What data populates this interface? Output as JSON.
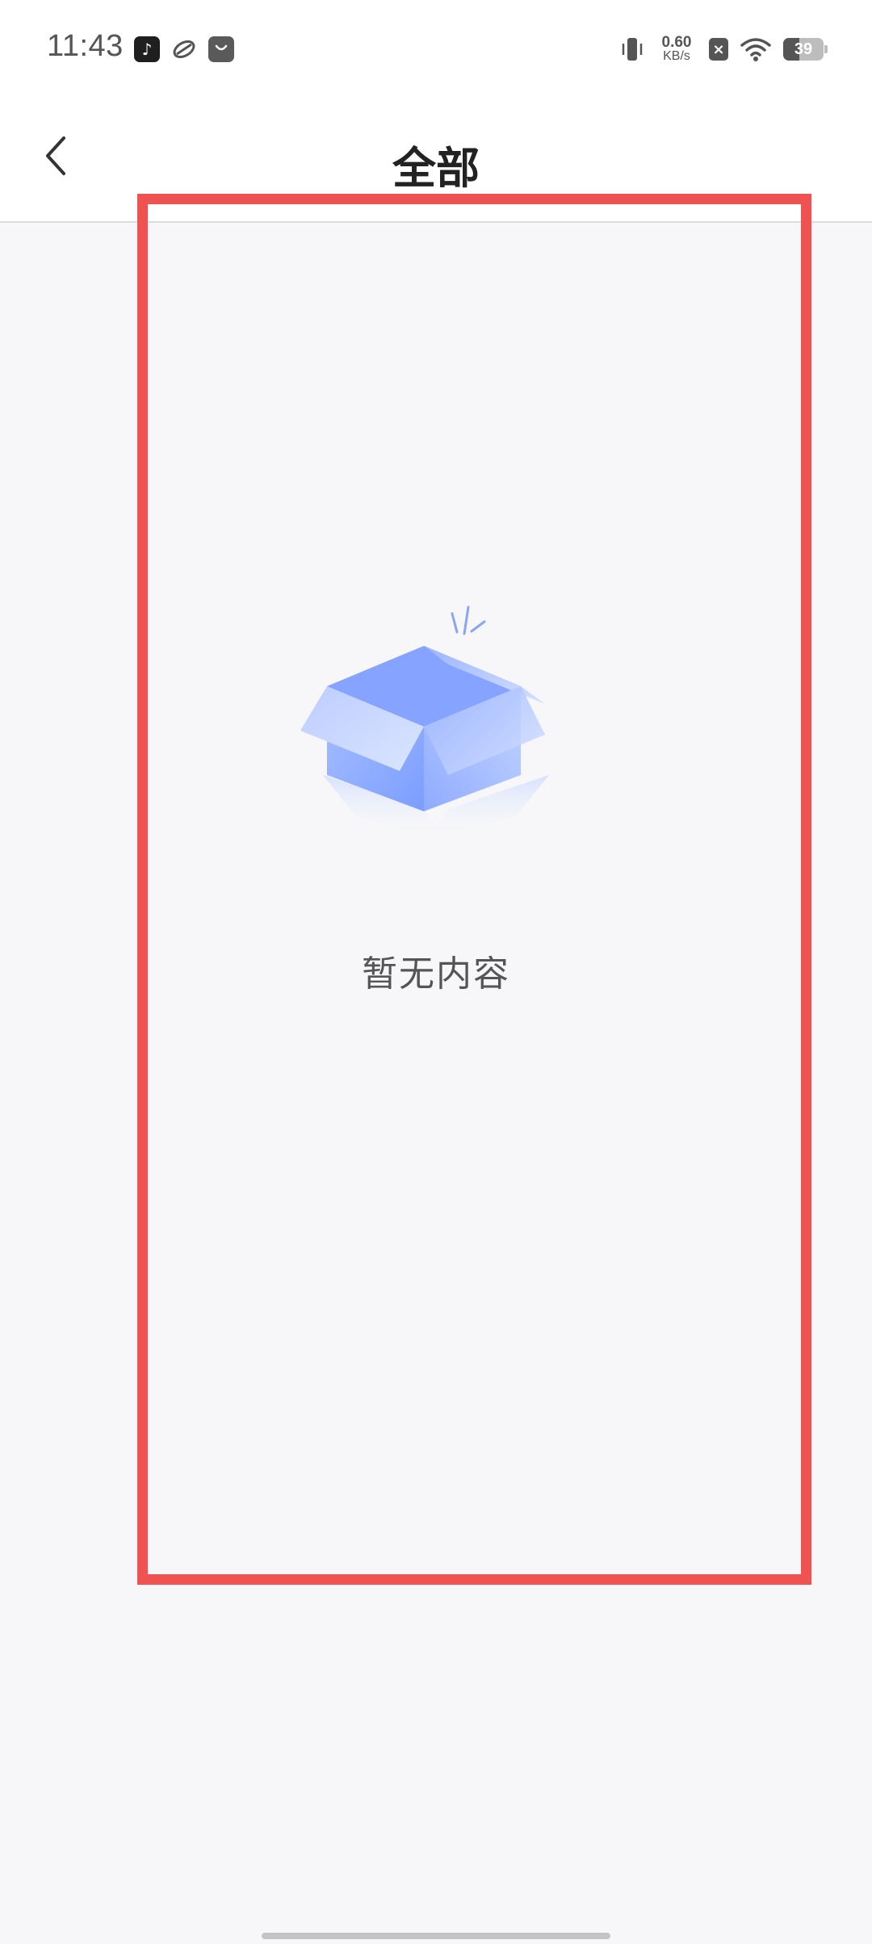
{
  "status_bar": {
    "time": "11:43",
    "net_speed_value": "0.60",
    "net_speed_unit": "KB/s",
    "battery_level": "39",
    "app_icons": [
      "tiktok-icon",
      "game-icon",
      "shopping-bag-icon"
    ]
  },
  "header": {
    "title": "全部",
    "back_icon": "chevron-left-icon"
  },
  "empty_state": {
    "message": "暂无内容",
    "illustration": "empty-box-icon"
  },
  "colors": {
    "highlight": "#f05252",
    "box_blue": "#7c9eff",
    "background": "#f7f7f9"
  }
}
